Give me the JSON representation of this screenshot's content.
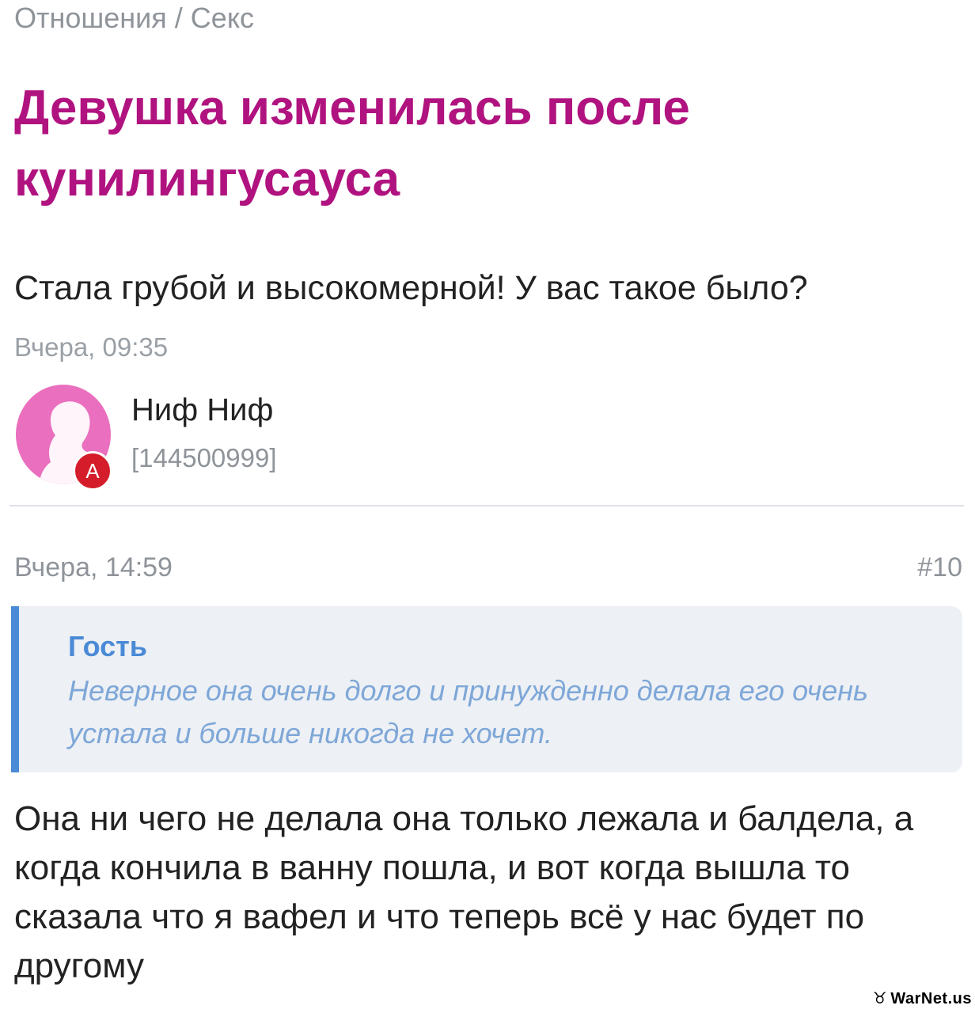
{
  "breadcrumb": {
    "category": "Отношения",
    "separator": "/",
    "subcategory": "Секс"
  },
  "question": {
    "title": "Девушка изменилась после кунилингусауса",
    "body": "Стала грубой и высокомерной! У вас такое было?",
    "date": "Вчера, 09:35"
  },
  "author": {
    "name": "Ниф Ниф",
    "id": "[144500999]",
    "badge": "A"
  },
  "answer": {
    "date": "Вчера, 14:59",
    "number": "#10",
    "quote": {
      "author": "Гость",
      "text": "Неверное она очень долго и принужденно делала его очень устала и больше никогда не хочет."
    },
    "body": "Она ни чего не делала она только лежала и балдела, а когда кончила в ванну пошла, и вот когда вышла то сказала что я вафел и что теперь всё у нас будет по другому"
  },
  "watermark": {
    "text": "WarNet.us"
  },
  "colors": {
    "title": "#b0137f",
    "meta_text": "#8f949a",
    "quote_accent": "#4a8ad6",
    "quote_text": "#7ea7d8",
    "quote_bg": "#edf0f4",
    "avatar": "#ea6fbe",
    "badge": "#d41c2a"
  }
}
